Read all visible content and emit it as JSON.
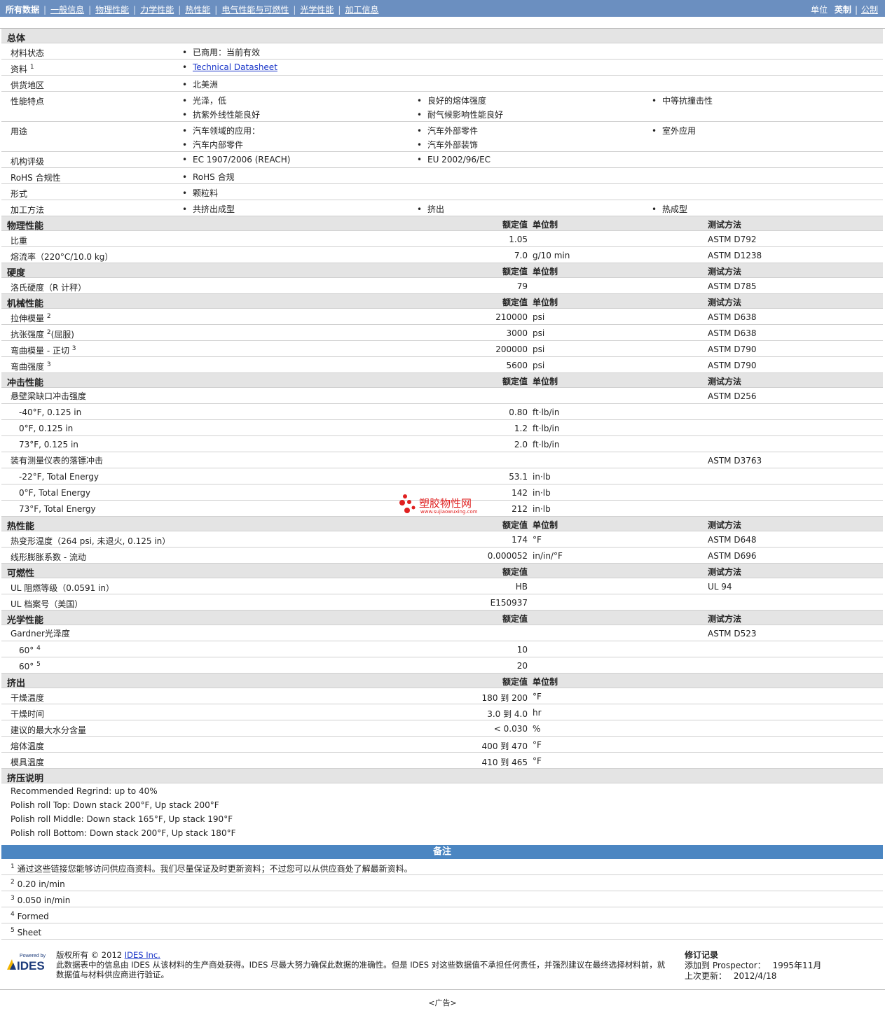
{
  "nav": {
    "items": [
      "所有数据",
      "一般信息",
      "物理性能",
      "力学性能",
      "热性能",
      "电气性能与可燃性",
      "光学性能",
      "加工信息"
    ],
    "units_label": "单位",
    "units_current": "英制",
    "units_alt": "公制"
  },
  "general": {
    "title": "总体",
    "status_label": "材料状态",
    "status_value": "已商用：当前有效",
    "resource_label": "资料",
    "resource_sup": "1",
    "resource_link": "Technical Datasheet",
    "region_label": "供货地区",
    "region_value": "北美洲",
    "features_label": "性能特点",
    "features": [
      "光泽，低",
      "良好的熔体强度",
      "中等抗撞击性",
      "抗紫外线性能良好",
      "耐气候影响性能良好"
    ],
    "uses_label": "用途",
    "uses": [
      "汽车领域的应用：",
      "汽车外部零件",
      "室外应用",
      "汽车内部零件",
      "汽车外部装饰"
    ],
    "agency_label": "机构评级",
    "agency": [
      "EC 1907/2006 (REACH)",
      "EU 2002/96/EC"
    ],
    "rohs_label": "RoHS 合规性",
    "rohs_value": "RoHS 合规",
    "form_label": "形式",
    "form_value": "颗粒料",
    "process_label": "加工方法",
    "process": [
      "共挤出成型",
      "挤出",
      "热成型"
    ]
  },
  "col_headers": {
    "value": "额定值",
    "unit": "单位制",
    "method": "测试方法"
  },
  "physical": {
    "title": "物理性能",
    "rows": [
      {
        "label": "比重",
        "value": "1.05",
        "unit": "",
        "method": "ASTM D792"
      },
      {
        "label": "熔流率（220°C/10.0 kg）",
        "value": "7.0",
        "unit": "g/10 min",
        "method": "ASTM D1238"
      }
    ]
  },
  "hardness": {
    "title": "硬度",
    "rows": [
      {
        "label": "洛氏硬度（R 计秤）",
        "value": "79",
        "unit": "",
        "method": "ASTM D785"
      }
    ]
  },
  "mechanical": {
    "title": "机械性能",
    "rows": [
      {
        "label": "拉伸模量",
        "sup": "2",
        "after": "",
        "value": "210000",
        "unit": "psi",
        "method": "ASTM D638"
      },
      {
        "label": "抗张强度",
        "sup": "2",
        "after": "(屈服)",
        "value": "3000",
        "unit": "psi",
        "method": "ASTM D638"
      },
      {
        "label": "弯曲模量 - 正切",
        "sup": "3",
        "after": "",
        "value": "200000",
        "unit": "psi",
        "method": "ASTM D790"
      },
      {
        "label": "弯曲强度",
        "sup": "3",
        "after": "",
        "value": "5600",
        "unit": "psi",
        "method": "ASTM D790"
      }
    ]
  },
  "impact": {
    "title": "冲击性能",
    "izod_label": "悬壁梁缺口冲击强度",
    "izod_method": "ASTM D256",
    "izod_rows": [
      {
        "label": "-40°F, 0.125 in",
        "value": "0.80",
        "unit": "ft·lb/in"
      },
      {
        "label": "0°F, 0.125 in",
        "value": "1.2",
        "unit": "ft·lb/in"
      },
      {
        "label": "73°F, 0.125 in",
        "value": "2.0",
        "unit": "ft·lb/in"
      }
    ],
    "dart_label": "装有测量仪表的落镖冲击",
    "dart_method": "ASTM D3763",
    "dart_rows": [
      {
        "label": "-22°F, Total Energy",
        "value": "53.1",
        "unit": "in·lb"
      },
      {
        "label": "0°F, Total Energy",
        "value": "142",
        "unit": "in·lb"
      },
      {
        "label": "73°F, Total Energy",
        "value": "212",
        "unit": "in·lb"
      }
    ]
  },
  "thermal": {
    "title": "热性能",
    "rows": [
      {
        "label": "热变形温度（264 psi, 未退火, 0.125 in）",
        "value": "174",
        "unit": "°F",
        "method": "ASTM D648"
      },
      {
        "label": "线形膨胀系数 - 流动",
        "value": "0.000052",
        "unit": "in/in/°F",
        "method": "ASTM D696"
      }
    ]
  },
  "flammability": {
    "title": "可燃性",
    "rows": [
      {
        "label": "UL 阻燃等级（0.0591 in）",
        "value": "HB",
        "unit": "",
        "method": "UL 94"
      },
      {
        "label": "UL 档案号（美国）",
        "value": "E150937",
        "unit": "",
        "method": ""
      }
    ]
  },
  "optical": {
    "title": "光学性能",
    "gloss_label": "Gardner光泽度",
    "gloss_method": "ASTM D523",
    "rows": [
      {
        "label": "60°",
        "sup": "4",
        "value": "10"
      },
      {
        "label": "60°",
        "sup": "5",
        "value": "20"
      }
    ]
  },
  "extrusion": {
    "title": "挤出",
    "rows": [
      {
        "label": "干燥温度",
        "value": "180 到 200",
        "unit": "°F"
      },
      {
        "label": "干燥时间",
        "value": "3.0 到 4.0",
        "unit": "hr"
      },
      {
        "label": "建议的最大水分含量",
        "value": "< 0.030",
        "unit": "%"
      },
      {
        "label": "熔体温度",
        "value": "400 到 470",
        "unit": "°F"
      },
      {
        "label": "模具温度",
        "value": "410 到 465",
        "unit": "°F"
      }
    ]
  },
  "extrusion_notes": {
    "title": "挤压说明",
    "lines": [
      "Recommended Regrind: up to 40%",
      "Polish roll Top: Down stack 200°F, Up stack 200°F",
      "Polish roll Middle: Down stack 165°F, Up stack 190°F",
      "Polish roll Bottom: Down stack 200°F, Up stack 180°F"
    ]
  },
  "notes": {
    "title": "备注",
    "items": [
      {
        "n": "1",
        "text": "通过这些链接您能够访问供应商资料。我们尽量保证及时更新资料；不过您可以从供应商处了解最新资料。"
      },
      {
        "n": "2",
        "text": "0.20 in/min"
      },
      {
        "n": "3",
        "text": "0.050 in/min"
      },
      {
        "n": "4",
        "text": "Formed"
      },
      {
        "n": "5",
        "text": "Sheet"
      }
    ]
  },
  "footer": {
    "logo_text_top": "Powered by",
    "logo_text": "IDES",
    "copyright_prefix": "版权所有 © 2012",
    "ides_link": "IDES Inc.",
    "disclaimer": "此数据表中的信息由 IDES 从该材料的生产商处获得。IDES 尽最大努力确保此数据的准确性。但是 IDES 对这些数据值不承担任何责任，并强烈建议在最终选择材料前，就数据值与材料供应商进行验证。",
    "rev_title": "修订记录",
    "added_label": "添加到 Prospector：",
    "added_value": "1995年11月",
    "updated_label": "上次更新：",
    "updated_value": "2012/4/18"
  },
  "ad_label": "<广告>",
  "watermark": {
    "text": "塑胶物性网",
    "sub": "www.sujiaowuxing.com"
  },
  "colors": {
    "topbar": "#6b8fc0",
    "notes_bar": "#4b86c2",
    "header_row": "#e4e4e4",
    "link": "#1a36c9"
  }
}
